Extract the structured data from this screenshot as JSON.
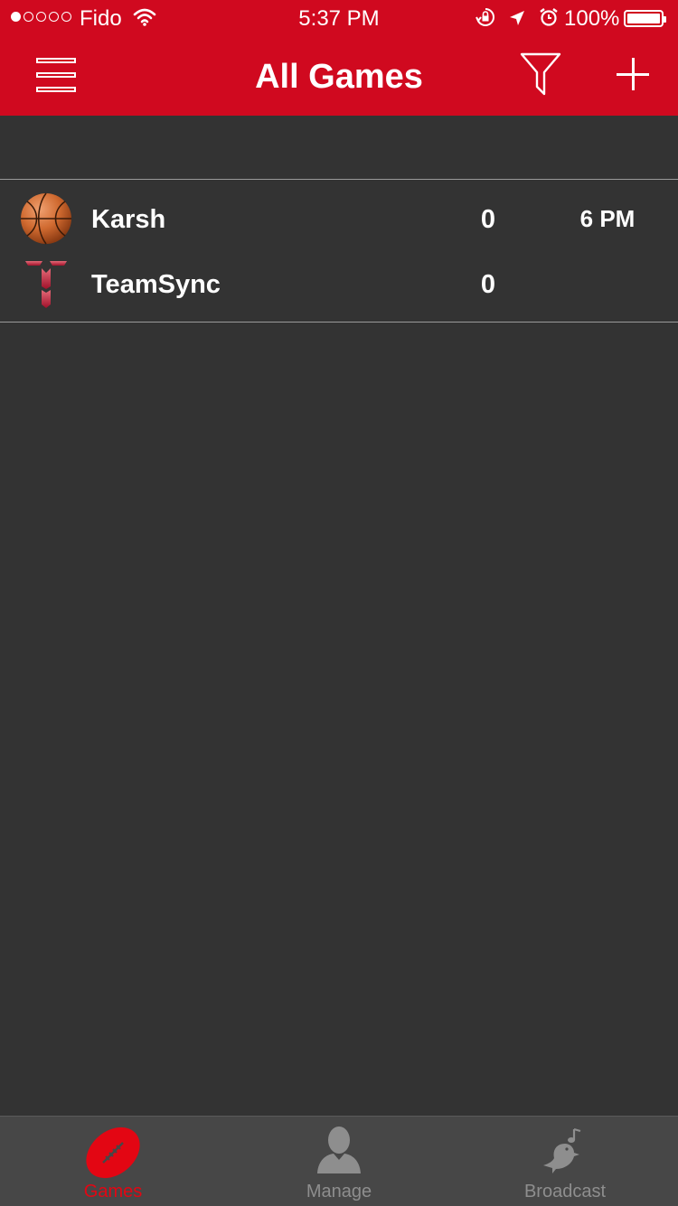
{
  "status_bar": {
    "carrier": "Fido",
    "time": "5:37 PM",
    "battery": "100%"
  },
  "nav": {
    "title": "All Games"
  },
  "games": [
    {
      "time": "6 PM",
      "teams": [
        {
          "name": "Karsh",
          "score": "0",
          "logo": "basketball-icon"
        },
        {
          "name": "TeamSync",
          "score": "0",
          "logo": "teamsync-logo-icon"
        }
      ]
    }
  ],
  "tabs": [
    {
      "label": "Games",
      "icon": "football-icon",
      "active": true
    },
    {
      "label": "Manage",
      "icon": "person-icon",
      "active": false
    },
    {
      "label": "Broadcast",
      "icon": "bird-icon",
      "active": false
    }
  ],
  "colors": {
    "header": "#d0091f",
    "background": "#333333",
    "tabbar": "#474747",
    "active_tab": "#e30613",
    "inactive_tab": "#8e8e8e"
  }
}
